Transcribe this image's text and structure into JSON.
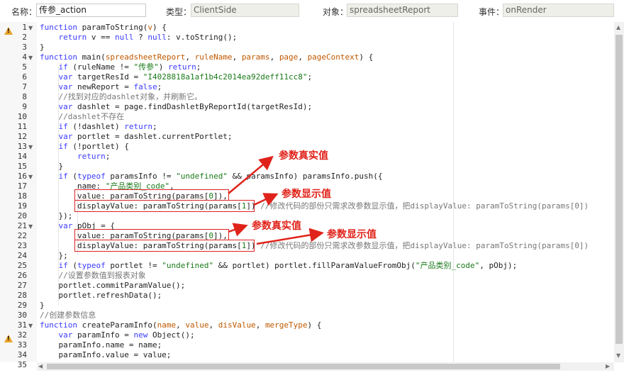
{
  "toolbar": {
    "name_label": "名称：",
    "name_value": "传参_action",
    "type_label": "类型：",
    "type_value": "ClientSide",
    "object_label": "对象：",
    "object_value": "spreadsheetReport",
    "event_label": "事件：",
    "event_value": "onRender"
  },
  "code_lines": [
    {
      "n": "1",
      "fold": true,
      "warn": true,
      "t": [
        [
          "k",
          "function "
        ],
        [
          "n",
          "paramToString("
        ],
        [
          "p",
          "v"
        ],
        [
          "n",
          ") {"
        ]
      ]
    },
    {
      "n": "2",
      "warn": true,
      "t": [
        [
          "n",
          "    "
        ],
        [
          "k",
          "return "
        ],
        [
          "n",
          "v == "
        ],
        [
          "k",
          "null"
        ],
        [
          "n",
          " ? "
        ],
        [
          "k",
          "null"
        ],
        [
          "n",
          ": v.toString();"
        ]
      ]
    },
    {
      "n": "3",
      "t": [
        [
          "n",
          "}"
        ]
      ]
    },
    {
      "n": "4",
      "fold": true,
      "t": [
        [
          "k",
          "function "
        ],
        [
          "n",
          "main("
        ],
        [
          "p",
          "spreadsheetReport"
        ],
        [
          "n",
          ", "
        ],
        [
          "p",
          "ruleName"
        ],
        [
          "n",
          ", "
        ],
        [
          "p",
          "params"
        ],
        [
          "n",
          ", "
        ],
        [
          "p",
          "page"
        ],
        [
          "n",
          ", "
        ],
        [
          "p",
          "pageContext"
        ],
        [
          "n",
          ") {"
        ]
      ]
    },
    {
      "n": "5",
      "t": [
        [
          "n",
          "    "
        ],
        [
          "k",
          "if"
        ],
        [
          "n",
          " (ruleName != "
        ],
        [
          "s",
          "\"传参\""
        ],
        [
          "n",
          ") "
        ],
        [
          "k",
          "return"
        ],
        [
          "n",
          ";"
        ]
      ]
    },
    {
      "n": "6",
      "t": [
        [
          "n",
          "    "
        ],
        [
          "k",
          "var "
        ],
        [
          "n",
          "targetResId = "
        ],
        [
          "s",
          "\"I4028818a1af1b4c2014ea92deff11cc8\""
        ],
        [
          "n",
          ";"
        ]
      ]
    },
    {
      "n": "7",
      "t": [
        [
          "n",
          "    "
        ],
        [
          "k",
          "var "
        ],
        [
          "n",
          "newReport = "
        ],
        [
          "k",
          "false"
        ],
        [
          "n",
          ";"
        ]
      ]
    },
    {
      "n": "8",
      "t": [
        [
          "n",
          "    "
        ],
        [
          "c",
          "//找到对应的dashlet对象，并刷新它。"
        ]
      ]
    },
    {
      "n": "9",
      "t": [
        [
          "n",
          "    "
        ],
        [
          "k",
          "var "
        ],
        [
          "n",
          "dashlet = page.findDashletByReportId(targetResId);"
        ]
      ]
    },
    {
      "n": "10",
      "t": [
        [
          "n",
          "    "
        ],
        [
          "c",
          "//dashlet不存在"
        ]
      ]
    },
    {
      "n": "11",
      "t": [
        [
          "n",
          "    "
        ],
        [
          "k",
          "if"
        ],
        [
          "n",
          " (!dashlet) "
        ],
        [
          "k",
          "return"
        ],
        [
          "n",
          ";"
        ]
      ]
    },
    {
      "n": "12",
      "t": [
        [
          "n",
          "    "
        ],
        [
          "k",
          "var "
        ],
        [
          "n",
          "portlet = dashlet.currentPortlet;"
        ]
      ]
    },
    {
      "n": "13",
      "fold": true,
      "t": [
        [
          "n",
          "    "
        ],
        [
          "k",
          "if"
        ],
        [
          "n",
          " (!portlet) {"
        ]
      ]
    },
    {
      "n": "14",
      "t": [
        [
          "n",
          "        "
        ],
        [
          "k",
          "return"
        ],
        [
          "n",
          ";"
        ]
      ]
    },
    {
      "n": "15",
      "t": [
        [
          "n",
          "    }"
        ]
      ]
    },
    {
      "n": "16",
      "fold": true,
      "t": [
        [
          "n",
          "    "
        ],
        [
          "k",
          "if"
        ],
        [
          "n",
          " ("
        ],
        [
          "k",
          "typeof"
        ],
        [
          "n",
          " paramsInfo != "
        ],
        [
          "s",
          "\"undefined\""
        ],
        [
          "n",
          " && paramsInfo) paramsInfo.push({"
        ]
      ]
    },
    {
      "n": "17",
      "t": [
        [
          "n",
          "        name: "
        ],
        [
          "s",
          "\"产品类别_code\""
        ],
        [
          "n",
          ","
        ]
      ]
    },
    {
      "n": "18",
      "t": [
        [
          "n",
          "        value: paramToString(params["
        ],
        [
          "s",
          "0"
        ],
        [
          "n",
          "]),"
        ]
      ]
    },
    {
      "n": "19",
      "t": [
        [
          "n",
          "        displayValue: paramToString(params["
        ],
        [
          "s",
          "1"
        ],
        [
          "n",
          "]) "
        ],
        [
          "c",
          "//修改代码的部份只需求改参数显示值，把displayValue: paramToString(params[0])"
        ]
      ]
    },
    {
      "n": "20",
      "t": [
        [
          "n",
          "    });"
        ]
      ]
    },
    {
      "n": "21",
      "fold": true,
      "t": [
        [
          "n",
          "    "
        ],
        [
          "k",
          "var "
        ],
        [
          "n",
          "pObj = {"
        ]
      ]
    },
    {
      "n": "22",
      "t": [
        [
          "n",
          "        value: paramToString(params["
        ],
        [
          "s",
          "0"
        ],
        [
          "n",
          "]),"
        ]
      ]
    },
    {
      "n": "23",
      "t": [
        [
          "n",
          "        displayValue: paramToString(params["
        ],
        [
          "s",
          "1"
        ],
        [
          "n",
          "]) "
        ],
        [
          "c",
          "//修改代码的部份只需求改参数显示值，把displayValue: paramToString(params[0])"
        ]
      ]
    },
    {
      "n": "24",
      "t": [
        [
          "n",
          "    };"
        ]
      ]
    },
    {
      "n": "25",
      "t": [
        [
          "n",
          "    "
        ],
        [
          "k",
          "if"
        ],
        [
          "n",
          " ("
        ],
        [
          "k",
          "typeof"
        ],
        [
          "n",
          " portlet != "
        ],
        [
          "s",
          "\"undefined\""
        ],
        [
          "n",
          " && portlet) portlet.fillParamValueFromObj("
        ],
        [
          "s",
          "\"产品类别_code\""
        ],
        [
          "n",
          ", pObj);"
        ]
      ]
    },
    {
      "n": "26",
      "t": [
        [
          "n",
          "    "
        ],
        [
          "c",
          "//设置参数值到报表对象"
        ]
      ]
    },
    {
      "n": "27",
      "t": [
        [
          "n",
          "    portlet.commitParamValue();"
        ]
      ]
    },
    {
      "n": "28",
      "t": [
        [
          "n",
          "    portlet.refreshData();"
        ]
      ]
    },
    {
      "n": "29",
      "t": [
        [
          "n",
          "}"
        ]
      ]
    },
    {
      "n": "30",
      "t": [
        [
          "c",
          "//创建参数信息"
        ]
      ]
    },
    {
      "n": "31",
      "fold": true,
      "t": [
        [
          "k",
          "function "
        ],
        [
          "n",
          "createParamInfo("
        ],
        [
          "p",
          "name"
        ],
        [
          "n",
          ", "
        ],
        [
          "p",
          "value"
        ],
        [
          "n",
          ", "
        ],
        [
          "p",
          "disValue"
        ],
        [
          "n",
          ", "
        ],
        [
          "p",
          "mergeType"
        ],
        [
          "n",
          ") {"
        ]
      ]
    },
    {
      "n": "32",
      "warn": true,
      "t": [
        [
          "n",
          "    "
        ],
        [
          "k",
          "var "
        ],
        [
          "n",
          "paramInfo = "
        ],
        [
          "k",
          "new "
        ],
        [
          "n",
          "Object();"
        ]
      ]
    },
    {
      "n": "33",
      "t": [
        [
          "n",
          "    paramInfo.name = name;"
        ]
      ]
    },
    {
      "n": "34",
      "t": [
        [
          "n",
          "    paramInfo.value = value;"
        ]
      ]
    },
    {
      "n": "35",
      "t": [
        [
          "n",
          ""
        ]
      ]
    }
  ],
  "annotations": {
    "a1": "参数真实值",
    "a2": "参数显示值",
    "a3": "参数真实值",
    "a4": "参数显示值"
  },
  "colors": {
    "keyword": "#3b3bff",
    "string": "#1a7a1a",
    "comment": "#777777",
    "param": "#c05800",
    "annotation": "#e0231a",
    "warning": "#e8a22a"
  },
  "icons": {
    "warning": "warning-icon",
    "fold": "fold-arrow-icon"
  }
}
